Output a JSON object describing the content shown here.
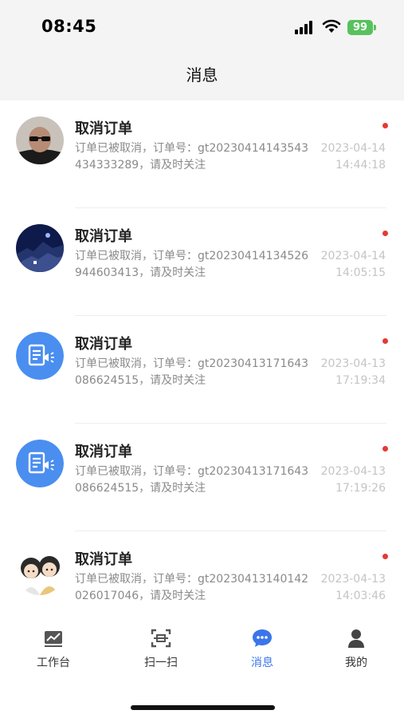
{
  "status_bar": {
    "time": "08:45",
    "battery": "99"
  },
  "nav": {
    "title": "消息"
  },
  "messages": [
    {
      "title": "取消订单",
      "body": "订单已被取消，订单号：gt20230414143543434333289，请及时关注",
      "date": "2023-04-14",
      "time": "14:44:18",
      "avatar": "photo-man-avatar",
      "unread": true
    },
    {
      "title": "取消订单",
      "body": "订单已被取消，订单号：gt20230414134526944603413，请及时关注",
      "date": "2023-04-14",
      "time": "14:05:15",
      "avatar": "photo-night-avatar",
      "unread": true
    },
    {
      "title": "取消订单",
      "body": "订单已被取消，订单号：gt20230413171643086624515，请及时关注",
      "date": "2023-04-13",
      "time": "17:19:34",
      "avatar": "notice-icon",
      "unread": true
    },
    {
      "title": "取消订单",
      "body": "订单已被取消，订单号：gt20230413171643086624515，请及时关注",
      "date": "2023-04-13",
      "time": "17:19:26",
      "avatar": "notice-icon",
      "unread": true
    },
    {
      "title": "取消订单",
      "body": "订单已被取消，订单号：gt20230413140142026017046，请及时关注",
      "date": "2023-04-13",
      "time": "14:03:46",
      "avatar": "cartoon-avatar",
      "unread": true
    }
  ],
  "tabs": [
    {
      "label": "工作台",
      "icon": "chart-icon",
      "active": false
    },
    {
      "label": "扫一扫",
      "icon": "scan-icon",
      "active": false
    },
    {
      "label": "消息",
      "icon": "chat-bubble-icon",
      "active": true
    },
    {
      "label": "我的",
      "icon": "person-icon",
      "active": false
    }
  ],
  "colors": {
    "accent": "#3a76ea",
    "unread_dot": "#e53935",
    "battery": "#58c15e"
  }
}
